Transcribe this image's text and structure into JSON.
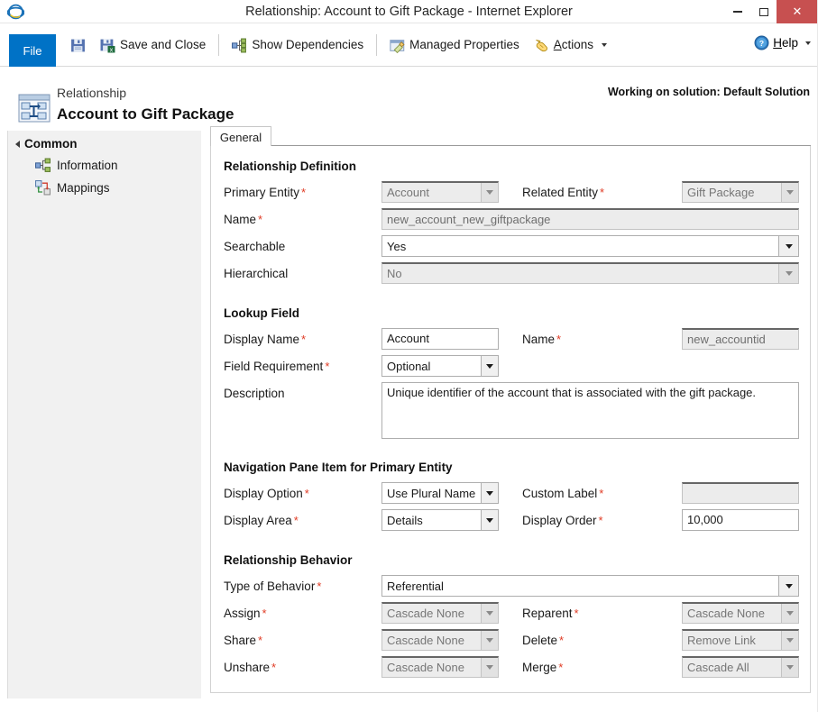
{
  "window": {
    "title": "Relationship: Account to Gift Package - Internet Explorer",
    "app_icon": "internet-explorer-icon",
    "controls": {
      "minimize": "–",
      "maximize": "□",
      "close": "✕"
    }
  },
  "ribbon": {
    "file_label": "File",
    "items": [
      {
        "label": "Save and Close",
        "icon": "save-and-close-icon"
      },
      {
        "label": "Show Dependencies",
        "icon": "dependencies-icon"
      },
      {
        "label": "Managed Properties",
        "icon": "managed-properties-icon"
      },
      {
        "label": "Actions",
        "icon": "actions-icon",
        "accel": "A",
        "has_menu": true
      }
    ],
    "help": {
      "label": "Help",
      "accel": "H",
      "icon": "help-icon",
      "has_menu": true
    }
  },
  "header": {
    "kicker": "Relationship",
    "title": "Account to Gift Package",
    "icon": "relationship-icon",
    "solution_note": "Working on solution: Default Solution"
  },
  "sidebar": {
    "group_label": "Common",
    "items": [
      {
        "label": "Information",
        "icon": "information-icon"
      },
      {
        "label": "Mappings",
        "icon": "mappings-icon"
      }
    ]
  },
  "tabs": [
    {
      "label": "General",
      "active": true
    }
  ],
  "form": {
    "sections": {
      "relationship_definition": {
        "title": "Relationship Definition",
        "primary_entity": {
          "label": "Primary Entity",
          "required": true,
          "value": "Account",
          "disabled": true
        },
        "related_entity": {
          "label": "Related Entity",
          "required": true,
          "value": "Gift Package",
          "disabled": true
        },
        "name": {
          "label": "Name",
          "required": true,
          "value": "new_account_new_giftpackage",
          "disabled": true
        },
        "searchable": {
          "label": "Searchable",
          "required": false,
          "value": "Yes",
          "disabled": false
        },
        "hierarchical": {
          "label": "Hierarchical",
          "required": false,
          "value": "No",
          "disabled": true
        }
      },
      "lookup_field": {
        "title": "Lookup Field",
        "display_name": {
          "label": "Display Name",
          "required": true,
          "value": "Account",
          "disabled": false
        },
        "name": {
          "label": "Name",
          "required": true,
          "value": "new_accountid",
          "disabled": true
        },
        "field_requirement": {
          "label": "Field Requirement",
          "required": true,
          "value": "Optional",
          "disabled": false
        },
        "description": {
          "label": "Description",
          "required": false,
          "value": "Unique identifier of the account that is associated with the gift package.",
          "disabled": false
        }
      },
      "navigation_pane": {
        "title": "Navigation Pane Item for Primary Entity",
        "display_option": {
          "label": "Display Option",
          "required": true,
          "value": "Use Plural Name",
          "disabled": false
        },
        "custom_label": {
          "label": "Custom Label",
          "required": true,
          "value": "",
          "disabled": true
        },
        "display_area": {
          "label": "Display Area",
          "required": true,
          "value": "Details",
          "disabled": false
        },
        "display_order": {
          "label": "Display Order",
          "required": true,
          "value": "10,000",
          "disabled": false
        }
      },
      "relationship_behavior": {
        "title": "Relationship Behavior",
        "type_of_behavior": {
          "label": "Type of Behavior",
          "required": true,
          "value": "Referential",
          "disabled": false
        },
        "assign": {
          "label": "Assign",
          "required": true,
          "value": "Cascade None",
          "disabled": true
        },
        "reparent": {
          "label": "Reparent",
          "required": true,
          "value": "Cascade None",
          "disabled": true
        },
        "share": {
          "label": "Share",
          "required": true,
          "value": "Cascade None",
          "disabled": true
        },
        "delete": {
          "label": "Delete",
          "required": true,
          "value": "Remove Link",
          "disabled": true
        },
        "unshare": {
          "label": "Unshare",
          "required": true,
          "value": "Cascade None",
          "disabled": true
        },
        "merge": {
          "label": "Merge",
          "required": true,
          "value": "Cascade All",
          "disabled": true
        }
      }
    }
  },
  "colors": {
    "file_blue": "#0072c6",
    "close_red": "#c75050",
    "required_red": "#e03b24",
    "sidebar_bg": "#f1f1f1"
  }
}
